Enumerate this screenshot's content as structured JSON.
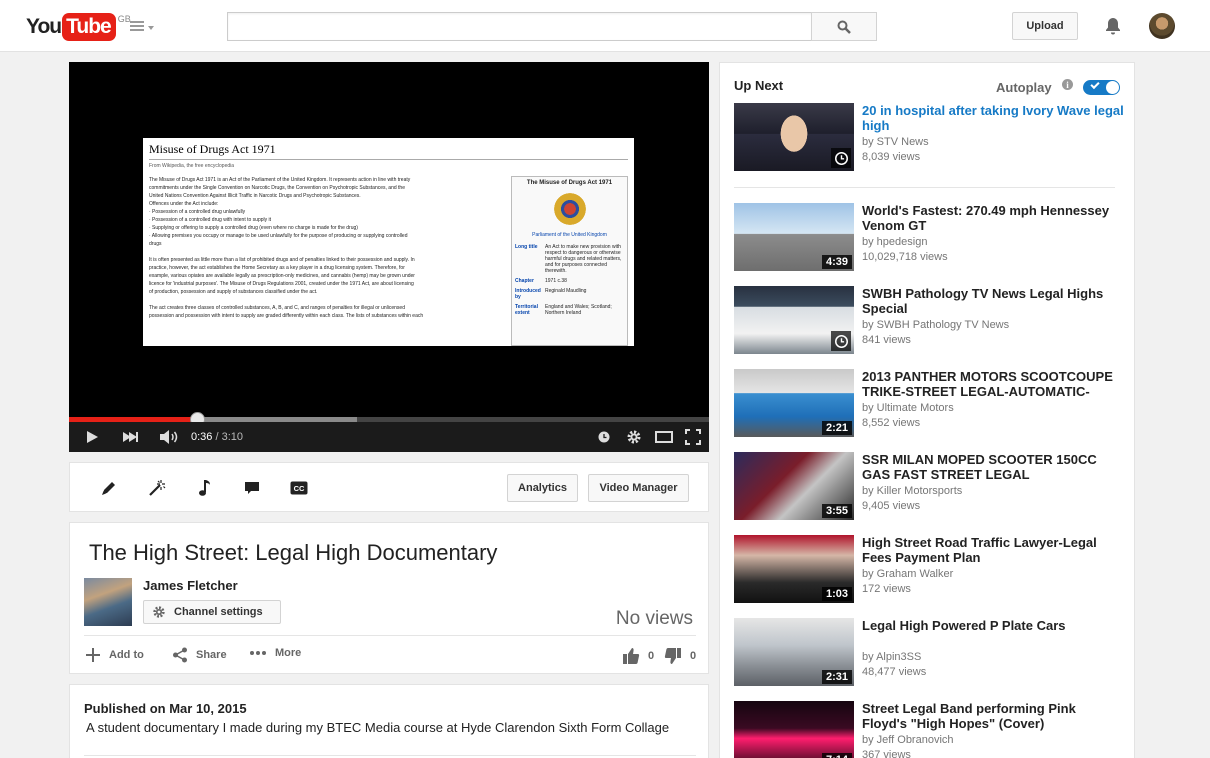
{
  "header": {
    "logo_you": "You",
    "logo_tube": "Tube",
    "region": "GB",
    "search_placeholder": "",
    "upload_label": "Upload"
  },
  "player": {
    "current_time": "0:36",
    "duration": " / 3:10",
    "played_fraction": 0.19,
    "buffered_fraction": 0.45,
    "frame": {
      "title": "Misuse of Drugs Act 1971",
      "subtitle": "From Wikipedia, the free encyclopedia",
      "box_title": "The Misuse of Drugs Act 1971",
      "box_caption": "Parliament of the United Kingdom",
      "lines": [
        "The Misuse of Drugs Act 1971 is an Act of the Parliament of the United Kingdom. It represents action in line with treaty",
        "commitments under the Single Convention on Narcotic Drugs, the Convention on Psychotropic Substances, and the",
        "United Nations Convention Against Illicit Traffic in Narcotic Drugs and Psychotropic Substances.",
        "Offences under the Act include:",
        "  · Possession of a controlled drug unlawfully",
        "  · Possession of a controlled drug with intent to supply it",
        "  · Supplying or offering to supply a controlled drug (even where no charge is made for the drug)",
        "  · Allowing premises you occupy or manage to be used unlawfully for the purpose of producing or supplying controlled",
        "    drugs",
        "",
        "It is often presented as little more than a list of prohibited drugs and of penalties linked to their possession and supply. In",
        "practice, however, the act establishes the Home Secretary as a key player in a drug licensing system. Therefore, for",
        "example, various opiates are available legally as prescription-only medicines, and cannabis (hemp) may be grown under",
        "licence for 'industrial purposes'. The Misuse of Drugs Regulations 2001, created under the 1971 Act, are about licensing",
        "of production, possession and supply of substances classified under the act.",
        "",
        "The act creates three classes of controlled substances, A, B, and C, and ranges of penalties for illegal or unlicensed",
        "possession and possession with intent to supply are graded differently within each class. The lists of substances within each"
      ],
      "box_rows": [
        {
          "k": "Long title",
          "v": "An Act to make new provision with respect to dangerous or otherwise harmful drugs and related matters, and for purposes connected therewith."
        },
        {
          "k": "Chapter",
          "v": "1971 c.38"
        },
        {
          "k": "Introduced by",
          "v": "Reginald Maudling"
        },
        {
          "k": "Territorial extent",
          "v": "England and Wales; Scotland; Northern Ireland"
        }
      ]
    }
  },
  "creator_bar": {
    "analytics_label": "Analytics",
    "video_manager_label": "Video Manager"
  },
  "video": {
    "title": "The High Street: Legal High Documentary",
    "owner": "James Fletcher",
    "channel_settings_label": "Channel settings",
    "views": "No views",
    "add_to_label": "Add to",
    "share_label": "Share",
    "more_label": "More",
    "likes": "0",
    "dislikes": "0",
    "published": "Published on Mar 10, 2015",
    "description": "A student documentary I made during my BTEC Media course at Hyde Clarendon Sixth Form Collage"
  },
  "sidebar": {
    "up_next_label": "Up Next",
    "autoplay_label": "Autoplay",
    "autoplay_on": true,
    "videos": [
      {
        "title": "20 in hospital after taking Ivory Wave legal high",
        "channel": "by STV News",
        "views": "8,039 views",
        "duration": "",
        "watch_later": true
      },
      {
        "title": "World's Fastest: 270.49 mph Hennessey Venom GT",
        "channel": "by hpedesign",
        "views": "10,029,718 views",
        "duration": "4:39",
        "watch_later": false
      },
      {
        "title": "SWBH Pathology TV News Legal Highs Special",
        "channel": "by SWBH Pathology TV News",
        "views": "841 views",
        "duration": "",
        "watch_later": true
      },
      {
        "title": "2013 PANTHER MOTORS SCOOTCOUPE TRIKE-STREET LEGAL-AUTOMATIC-",
        "channel": "by Ultimate Motors",
        "views": "8,552 views",
        "duration": "2:21",
        "watch_later": false
      },
      {
        "title": "SSR MILAN MOPED SCOOTER 150CC GAS FAST STREET LEGAL",
        "channel": "by Killer Motorsports",
        "views": "9,405 views",
        "duration": "3:55",
        "watch_later": false
      },
      {
        "title": "High Street Road Traffic Lawyer-Legal Fees Payment Plan",
        "channel": "by Graham Walker",
        "views": "172 views",
        "duration": "1:03",
        "watch_later": false
      },
      {
        "title": "Legal High Powered P Plate Cars",
        "channel": "by Alpin3SS",
        "views": "48,477 views",
        "duration": "2:31",
        "watch_later": false
      },
      {
        "title": "Street Legal Band performing Pink Floyd's \"High Hopes\" (Cover)",
        "channel": "by Jeff Obranovich",
        "views": "367 views",
        "duration": "7:14",
        "watch_later": false
      }
    ]
  }
}
